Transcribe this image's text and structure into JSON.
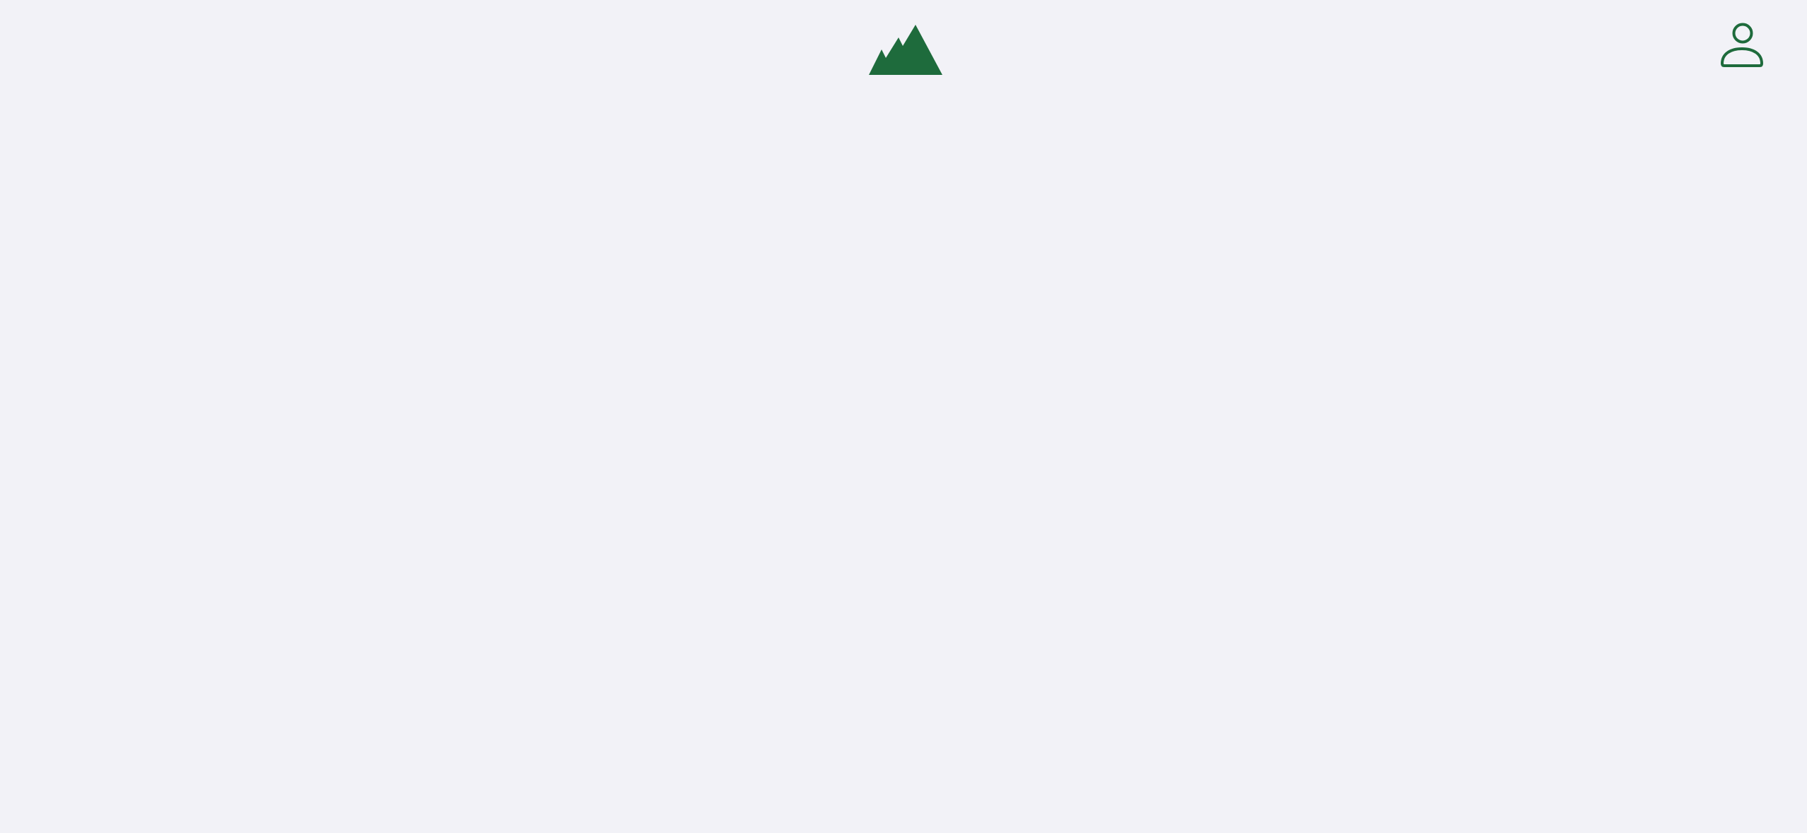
{
  "header": {
    "logo_icon": "mountains-logo-icon",
    "account_icon": "person-icon"
  },
  "colors": {
    "background": "#f2f2f7",
    "brand_green": "#1e6b3c"
  }
}
